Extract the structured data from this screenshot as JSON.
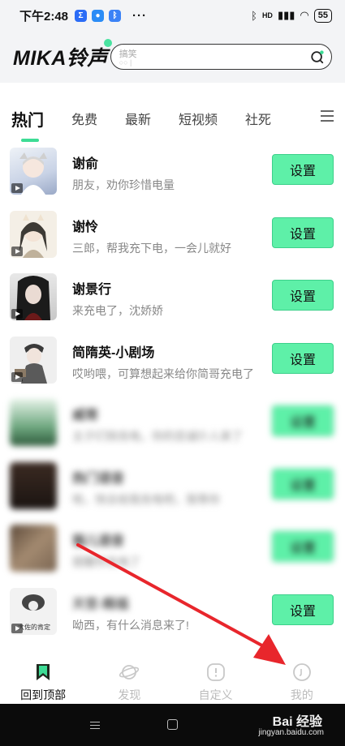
{
  "status_bar": {
    "time": "下午2:48",
    "app_icons": [
      {
        "name": "sigma-app-icon",
        "glyph": "Σ",
        "color": "#2b6cf6"
      },
      {
        "name": "chat-app-icon",
        "glyph": "●",
        "color": "#2b8cf6"
      },
      {
        "name": "bluetooth-app-icon",
        "glyph": "ᛒ",
        "color": "#3b82f6"
      }
    ],
    "more": "···",
    "network": "HD",
    "battery": "55"
  },
  "header": {
    "logo": "MIKA铃声",
    "search_placeholder": "搞笑",
    "search_hint": "○○ |"
  },
  "tabs": {
    "items": [
      "热门",
      "免费",
      "最新",
      "短视频",
      "社死"
    ],
    "active_index": 0
  },
  "list": {
    "button_label": "设置",
    "items": [
      {
        "title": "谢俞",
        "subtitle": "朋友，劝你珍惜电量",
        "thumb_colors": [
          "#eef2f7",
          "#9aa9c7"
        ],
        "blurred": false
      },
      {
        "title": "谢怜",
        "subtitle": "三郎，帮我充下电，一会儿就好",
        "thumb_colors": [
          "#f4efe6",
          "#3d3a35"
        ],
        "blurred": false
      },
      {
        "title": "谢景行",
        "subtitle": "来充电了，沈娇娇",
        "thumb_colors": [
          "#dcdcdc",
          "#1b1b1b"
        ],
        "blurred": false
      },
      {
        "title": "简隋英-小剧场",
        "subtitle": "哎哟喂，可算想起来给你简哥充电了",
        "thumb_colors": [
          "#efefef",
          "#5a5a5a"
        ],
        "blurred": false
      },
      {
        "title": "威哥",
        "subtitle": "主子们快充电，你的忠诚仆人来了",
        "thumb_colors": [
          "#e4f2e7",
          "#2e5a3b"
        ],
        "blurred": true
      },
      {
        "title": "热门语音",
        "subtitle": "哈，快去给我充电吧，我等你",
        "thumb_colors": [
          "#3b2a22",
          "#1a1411"
        ],
        "blurred": true
      },
      {
        "title": "猫儿语音",
        "subtitle": "提醒你充电了",
        "thumb_colors": [
          "#5d4a3a",
          "#7a6552"
        ],
        "blurred": true
      },
      {
        "title": "天官-赐福",
        "subtitle": "呦西，有什么消息来了!",
        "thumb_colors": [
          "#f2f2f2",
          "#444444"
        ],
        "blurred": false,
        "caption": "大佐的肯定",
        "title_blurred": true
      }
    ]
  },
  "bottom_nav": {
    "items": [
      {
        "label": "回到顶部",
        "icon": "bookmark-icon",
        "active": true
      },
      {
        "label": "发现",
        "icon": "planet-icon",
        "active": false
      },
      {
        "label": "自定义",
        "icon": "custom-phone-icon",
        "active": false
      },
      {
        "label": "我的",
        "icon": "profile-icon",
        "active": false
      }
    ]
  },
  "watermark": {
    "text": "Bai 经验",
    "url_text": "jingyan.baidu.com"
  },
  "colors": {
    "accent": "#3ddc95",
    "button": "#5ef0a8",
    "annotation_arrow": "#e8262c"
  }
}
